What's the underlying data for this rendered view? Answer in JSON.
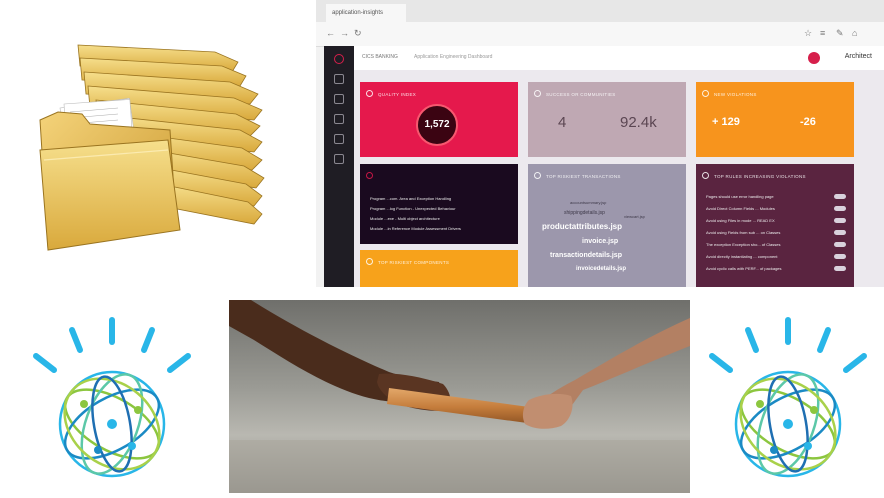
{
  "browser": {
    "tab_title": "application-insights",
    "user_name": "Architect"
  },
  "app": {
    "title": "CICS BANKING",
    "subtitle": "Application Engineering Dashboard"
  },
  "dashboard": {
    "quality_index": {
      "title": "QUALITY INDEX",
      "value": "1,572"
    },
    "success_summary": {
      "title": "SUCCESS OR COMMUNITIES",
      "value_a": "4",
      "value_b": "92.4k"
    },
    "new_violations": {
      "title": "NEW VIOLATIONS",
      "value_a": "+ 129",
      "value_b": "-26"
    },
    "risk_list": {
      "items": [
        "Program ...com. Area and Exception Handling",
        "Program ...log Function - Unexpected Behaviour",
        "Module ...exe - Multi object architecture",
        "Module ...in Reference Module Assessment Drivers"
      ]
    },
    "top_transactions": {
      "title": "TOP RISKIEST TRANSACTIONS",
      "words": [
        "productattributes.jsp",
        "invoice.jsp",
        "transactiondetails.jsp",
        "invoicedetails.jsp",
        "accountsummary.jsp",
        "viewcart.jsp",
        "shippingdetails.jsp"
      ]
    },
    "top_rules": {
      "title": "TOP RULES INCREASING VIOLATIONS",
      "items": [
        "Pages should use error handling page",
        "Avoid Direct Column Fields ... Modules",
        "Avoid using Files in mode ... READ EX",
        "Avoid using Fields from sub ... on Classes",
        "The exception Exception sho... of Classes",
        "Avoid directly instantiating ... component",
        "Avoid cyclic calls with PERF... of packages"
      ]
    },
    "top_components": {
      "title": "TOP RISKIEST COMPONENTS"
    }
  },
  "colors": {
    "quality_card": "#e5194c",
    "success_card": "#bfa8b3",
    "violations_card": "#f7941d",
    "risk_card": "#1a0a1f",
    "transactions_card": "#9c97ac",
    "rules_card": "#5a2440",
    "components_card": "#f7a21b",
    "folder_yellow": "#e7c65e",
    "watson_blue": "#29b6e8",
    "watson_green": "#8cc63f"
  },
  "icons": [
    "folder-stack-icon",
    "watson-logo-icon",
    "relay-baton-photo"
  ]
}
